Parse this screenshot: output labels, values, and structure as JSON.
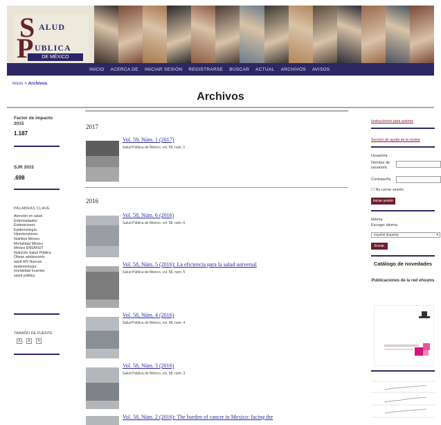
{
  "header": {
    "logo_letter_s": "S",
    "logo_letter_p": "P",
    "logo_line1": "ALUD",
    "logo_line2": "UBLICA",
    "logo_line3": "DE MÉXICO",
    "banner_colors": [
      "#3a2f2a",
      "#7c4d3a",
      "#a8784f",
      "#2a2a2a",
      "#8c5b45",
      "#4a3c36",
      "#6d7c8a",
      "#3d3833",
      "#b2865c",
      "#584a40",
      "#2f2d36",
      "#9b6a4c",
      "#4d5560",
      "#7a4a38"
    ]
  },
  "nav": {
    "items": [
      "INICIO",
      "ACERCA DE",
      "INICIAR SESIÓN",
      "REGISTRARSE",
      "BUSCAR",
      "ACTUAL",
      "ARCHIVOS",
      "AVISOS"
    ]
  },
  "breadcrumb": {
    "home": "Inicio",
    "separator": ">",
    "current": "Archivos"
  },
  "page": {
    "title": "Archivos"
  },
  "left": {
    "impact_label": "Factor de impacto 2015",
    "impact_value": "1.187",
    "sjr_label": "SJR 2015",
    "sjr_value": ".698",
    "keywords_heading": "PALABRAS CLAVE",
    "keywords": [
      "Atención en salud",
      "Enfermedades",
      "Estimaciones",
      "Epidemiología",
      "Hipertensiones",
      "Nutrition Mexico",
      "Mortalidad México",
      "México ENSANUT",
      "Nutrición Salud Pública",
      "Obese adolescents",
      "adult HIV Nuevas",
      "epidemiología",
      "mortalidad muertes",
      "salud pública"
    ],
    "font_size_label": "TAMAÑO DE FUENTE"
  },
  "archive": {
    "groups": [
      {
        "year": "2017",
        "issues": [
          {
            "title": "Vol. 59, Núm. 1 (2017)",
            "subtitle": "Salud Pública de México, vol. 59, núm. 1"
          }
        ]
      },
      {
        "year": "2016",
        "issues": [
          {
            "title": "Vol. 58, Núm. 6 (2016)",
            "subtitle": "Salud Pública de México, vol. 58, núm. 6"
          },
          {
            "title": "Vol. 58, Núm. 5 (2016): La eficiencia para la salud universal",
            "subtitle": "Salud Pública de México, vol. 58, núm. 5"
          },
          {
            "title": "Vol. 58, Núm. 4 (2016)",
            "subtitle": "Salud Pública de México, vol. 58, núm. 4"
          },
          {
            "title": "Vol. 58, Núm. 3 (2016)",
            "subtitle": "Salud Pública de México, vol. 58, núm. 3"
          },
          {
            "title": "Vol. 58, Núm. 2 (2016): The burden of cancer in Mexico: facing the",
            "subtitle": ""
          }
        ]
      }
    ]
  },
  "right": {
    "authors_link": "Instrucciones para autores",
    "journal_help_link": "Servicio de ayuda de la revista",
    "user_heading": "Usuario/a",
    "username_label": "Nombre de usuario/a",
    "password_label": "Contraseña",
    "remember_label": "No cerrar sesión",
    "login_button": "Iniciar sesión",
    "language_heading": "Idioma",
    "language_label": "Escoger idioma",
    "language_value": "Español (España)",
    "submit_button": "Enviar",
    "catalog_title": "Catálogo de novedades",
    "catalog_sub": "Publicaciones de la red ehssms"
  }
}
